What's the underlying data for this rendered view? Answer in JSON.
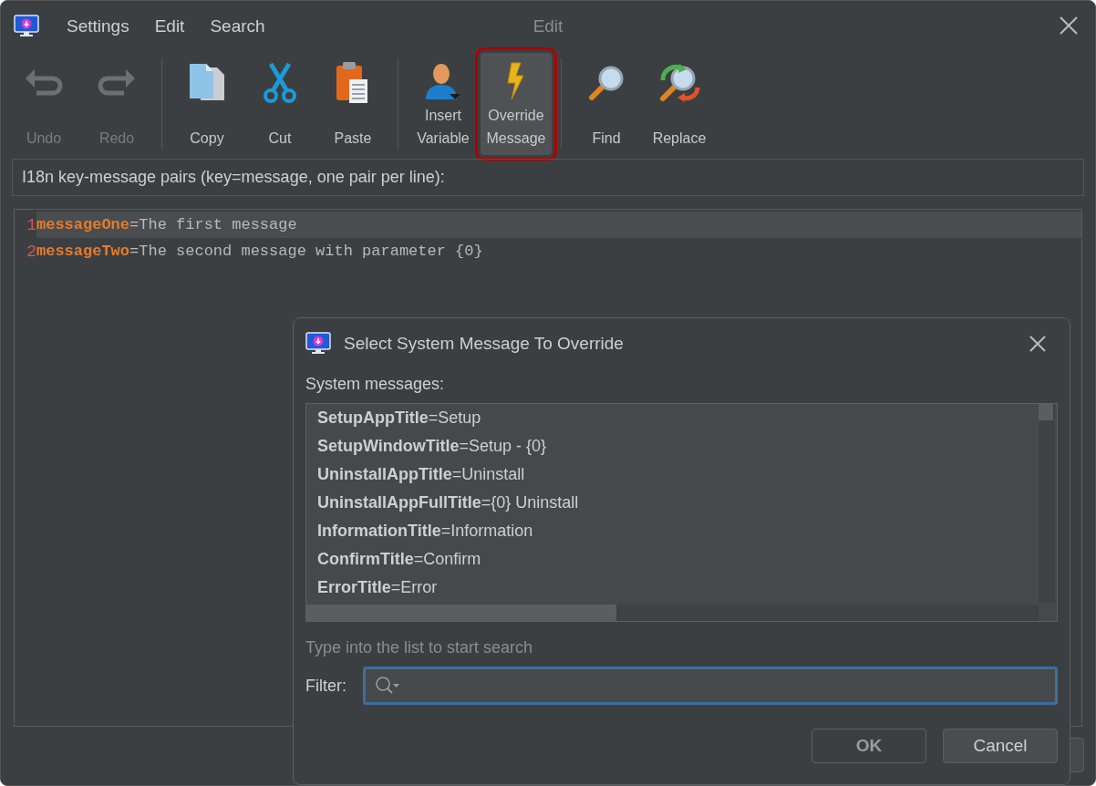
{
  "window": {
    "menu": [
      "Settings",
      "Edit",
      "Search"
    ],
    "title": "Edit"
  },
  "toolbar": [
    {
      "kind": "undo",
      "label": "Undo",
      "disabled": true,
      "selected": false
    },
    {
      "kind": "redo",
      "label": "Redo",
      "disabled": true,
      "selected": false
    },
    {
      "kind": "separator"
    },
    {
      "kind": "copy",
      "label": "Copy",
      "disabled": false,
      "selected": false
    },
    {
      "kind": "cut",
      "label": "Cut",
      "disabled": false,
      "selected": false
    },
    {
      "kind": "paste",
      "label": "Paste",
      "disabled": false,
      "selected": false
    },
    {
      "kind": "separator"
    },
    {
      "kind": "variable",
      "label": "Insert\nVariable",
      "disabled": false,
      "selected": false
    },
    {
      "kind": "override",
      "label": "Override\nMessage",
      "disabled": false,
      "selected": true
    },
    {
      "kind": "separator"
    },
    {
      "kind": "find",
      "label": "Find",
      "disabled": false,
      "selected": false
    },
    {
      "kind": "replace",
      "label": "Replace",
      "disabled": false,
      "selected": false
    }
  ],
  "pairs_label": "I18n key-message pairs (key=message, one pair per line):",
  "editor": {
    "lines": [
      {
        "number": "1",
        "key": "messageOne",
        "value": "=The first message",
        "current": true
      },
      {
        "number": "2",
        "key": "messageTwo",
        "value": "=The second message with parameter {0}",
        "current": false
      }
    ]
  },
  "dialog": {
    "title": "Select System Message To Override",
    "list_label": "System messages:",
    "messages": [
      "**SetupAppTitle**=Setup",
      "**SetupWindowTitle**=Setup - {0}",
      "**UninstallAppTitle**=Uninstall",
      "**UninstallAppFullTitle**={0} Uninstall",
      "**InformationTitle**=Information",
      "**ConfirmTitle**=Confirm",
      "**ErrorTitle**=Error"
    ],
    "hint": "Type into the list to start search",
    "filter_label": "Filter:",
    "buttons": [
      {
        "label": "OK",
        "kind": "default"
      },
      {
        "label": "Cancel",
        "kind": "normal"
      }
    ]
  }
}
